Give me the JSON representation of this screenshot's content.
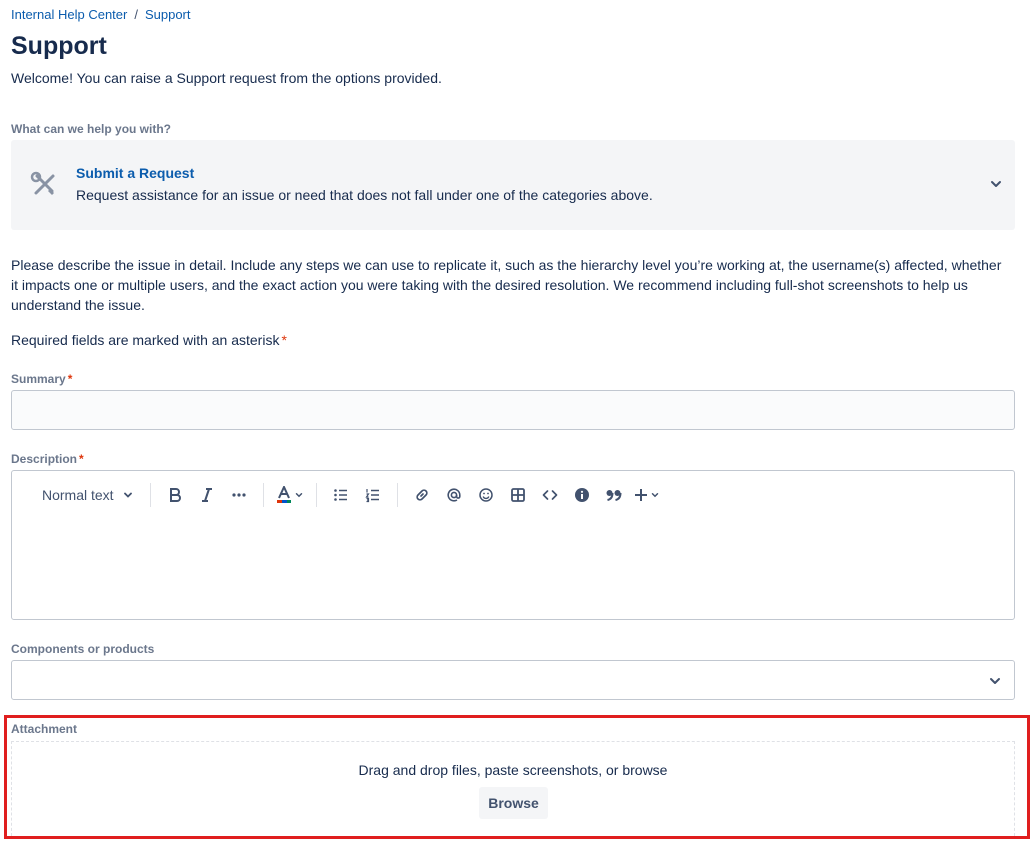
{
  "breadcrumb": {
    "items": [
      "Internal Help Center",
      "Support"
    ],
    "separator": "/"
  },
  "page": {
    "title": "Support",
    "welcome": "Welcome! You can raise a Support request from the options provided."
  },
  "request_type": {
    "label": "What can we help you with?",
    "icon": "tools-icon",
    "title": "Submit a Request",
    "description": "Request assistance for an issue or need that does not fall under one of the categories above."
  },
  "instructions": "Please describe the issue in detail. Include any steps we can use to replicate it, such as the hierarchy level you’re working at, the username(s) affected, whether it impacts one or multiple users, and the exact action you were taking with the desired resolution. We recommend including full-shot screenshots to help us understand the issue.",
  "required_note": {
    "text": "Required fields are marked with an asterisk",
    "asterisk": "*"
  },
  "fields": {
    "summary": {
      "label": "Summary",
      "asterisk": "*",
      "value": ""
    },
    "description": {
      "label": "Description",
      "asterisk": "*",
      "toolbar": {
        "text_style": "Normal text",
        "tools": [
          "bold-icon",
          "italic-icon",
          "more-formatting-icon",
          "text-color-icon",
          "bullet-list-icon",
          "numbered-list-icon",
          "link-icon",
          "mention-icon",
          "emoji-icon",
          "table-icon",
          "code-icon",
          "info-panel-icon",
          "quote-icon",
          "insert-plus-icon"
        ]
      }
    },
    "components": {
      "label": "Components or products",
      "value": ""
    },
    "attachment": {
      "label": "Attachment",
      "drop_text": "Drag and drop files, paste screenshots, or browse",
      "browse_label": "Browse"
    }
  },
  "colors": {
    "link": "#0b5cad",
    "text": "#172b4d",
    "label": "#6b778c",
    "required": "#de350b",
    "highlight": "#e01e1e",
    "panel_bg": "#f4f5f7"
  }
}
